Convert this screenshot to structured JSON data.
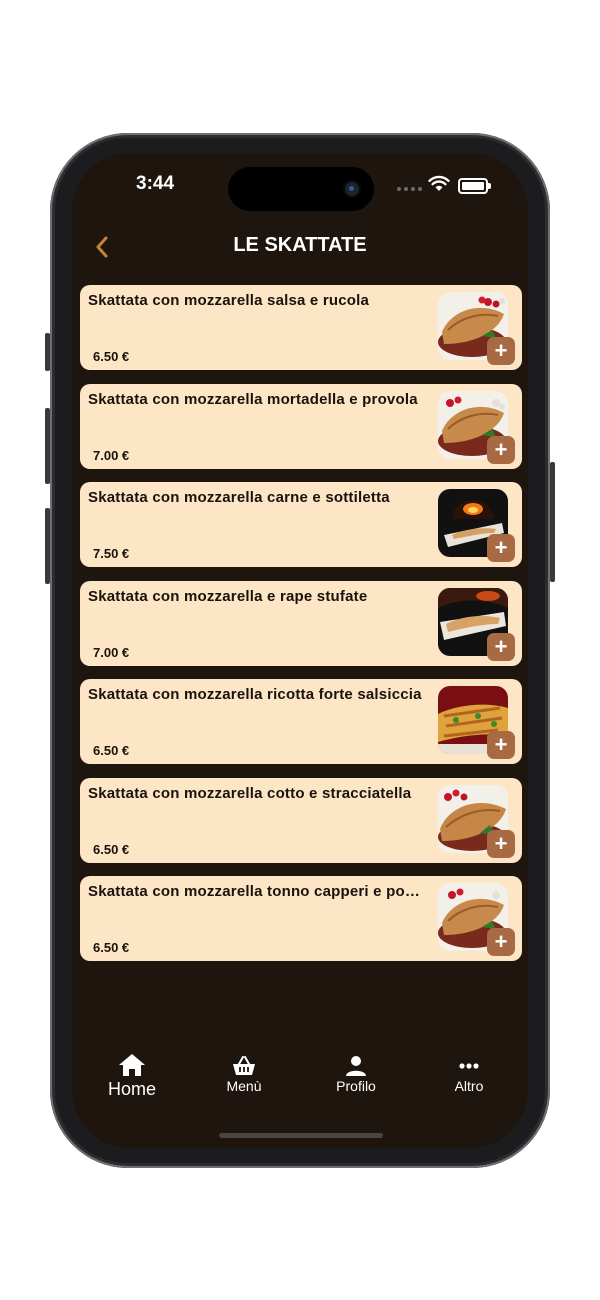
{
  "status_bar": {
    "time": "3:44"
  },
  "header": {
    "title": "LE SKATTATE"
  },
  "colors": {
    "background": "#1e150f",
    "card": "#fde6c6",
    "accent": "#c88435",
    "add_button": "#a86a42"
  },
  "items": [
    {
      "name": "Skattata con mozzarella salsa e rucola",
      "price": "6.50 €",
      "image": "skattata-calzone-photo"
    },
    {
      "name": "Skattata con mozzarella mortadella e provola",
      "price": "7.00 €",
      "image": "skattata-calzone-photo"
    },
    {
      "name": "Skattata con mozzarella carne e sottiletta",
      "price": "7.50 €",
      "image": "wood-oven-photo"
    },
    {
      "name": "Skattata con mozzarella e rape stufate",
      "price": "7.00 €",
      "image": "wood-oven-photo"
    },
    {
      "name": "Skattata con mozzarella ricotta forte salsiccia",
      "price": "6.50 €",
      "image": "grilled-skattata-photo"
    },
    {
      "name": "Skattata con mozzarella cotto e stracciatella",
      "price": "6.50 €",
      "image": "skattata-calzone-photo"
    },
    {
      "name": "Skattata con mozzarella tonno capperi e pomodoro",
      "price": "6.50 €",
      "image": "skattata-calzone-photo"
    }
  ],
  "add_label": "+",
  "tabbar": {
    "home": {
      "label": "Home",
      "icon": "house-icon"
    },
    "menu": {
      "label": "Menù",
      "icon": "basket-icon"
    },
    "profile": {
      "label": "Profilo",
      "icon": "person-icon"
    },
    "more": {
      "label": "Altro",
      "icon": "ellipsis-icon"
    }
  }
}
